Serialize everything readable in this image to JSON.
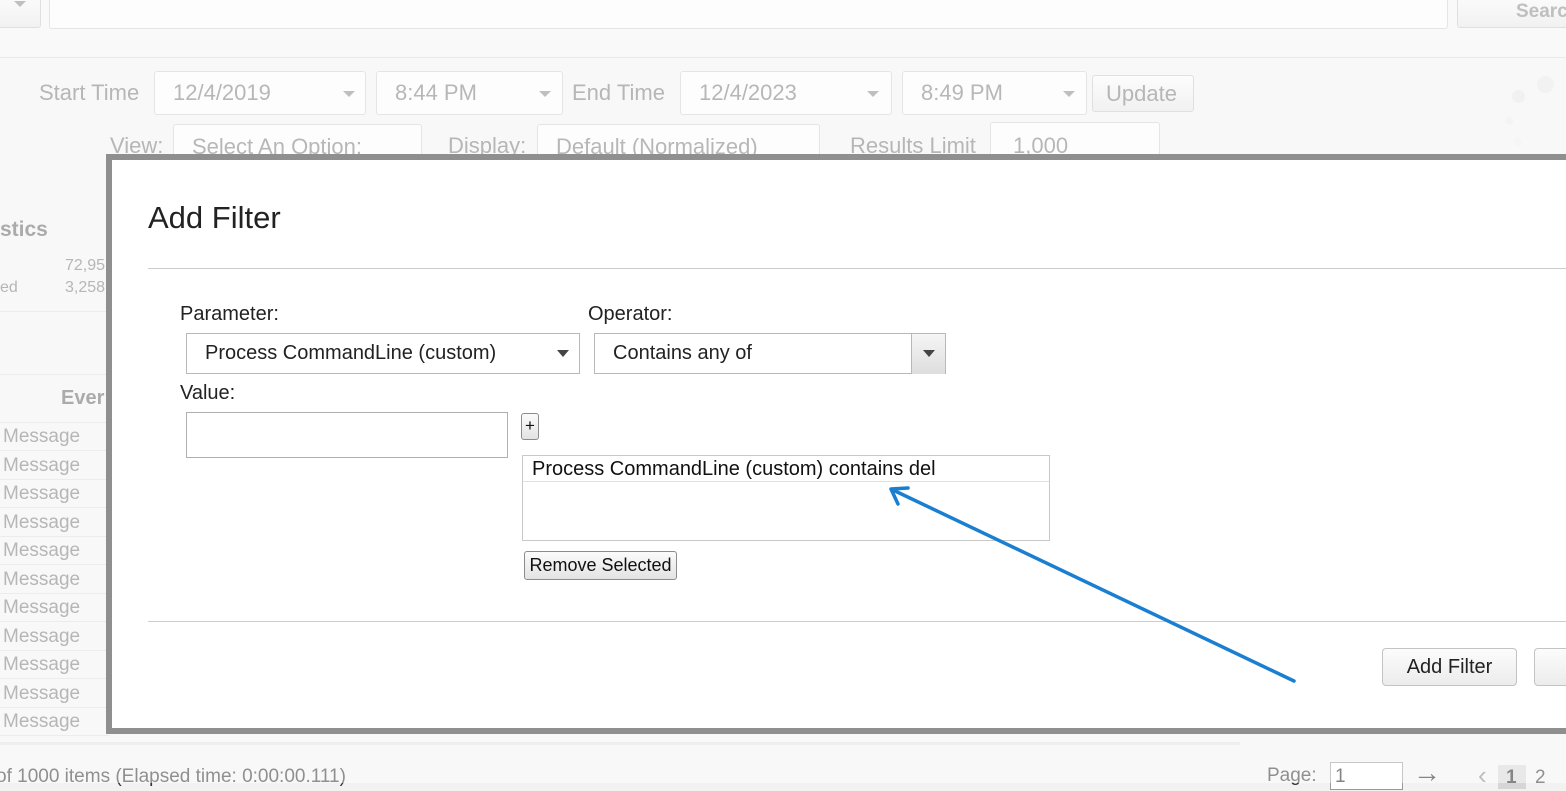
{
  "top": {
    "search_label": "Searc"
  },
  "time": {
    "start_label": "Start Time",
    "start_date": "12/4/2019",
    "start_time": "8:44 PM",
    "end_label": "End Time",
    "end_date": "12/4/2023",
    "end_time": "8:49 PM",
    "update_label": "Update"
  },
  "view_row": {
    "view_label": "View:",
    "view_value": "Select An Option:",
    "display_label": "Display:",
    "display_value": "Default (Normalized)",
    "results_limit_label": "Results Limit",
    "results_limit_value": "1,000"
  },
  "stats": {
    "title": "stics",
    "row1_value": "72,95",
    "row2_label": "ed",
    "row2_value": "3,258"
  },
  "table": {
    "header": "Ever",
    "rows": [
      "Message",
      "Message",
      "Message",
      "Message",
      "Message",
      "Message",
      "Message",
      "Message",
      "Message",
      "Message",
      "Message"
    ]
  },
  "modal": {
    "title": "Add Filter",
    "parameter_label": "Parameter:",
    "parameter_value": "Process CommandLine (custom)",
    "operator_label": "Operator:",
    "operator_value": "Contains any of",
    "value_label": "Value:",
    "value_input": "",
    "plus_label": "+",
    "list_items": [
      "Process CommandLine (custom) contains del"
    ],
    "remove_selected_label": "Remove Selected",
    "add_filter_label": "Add Filter"
  },
  "footer": {
    "items_text": "of 1000 items (Elapsed time: 0:00:00.111)",
    "page_label": "Page:",
    "page_value": "1",
    "current_page": "1",
    "next_page": "2"
  },
  "annotation": {
    "arrow_color": "#1a7fd1"
  }
}
